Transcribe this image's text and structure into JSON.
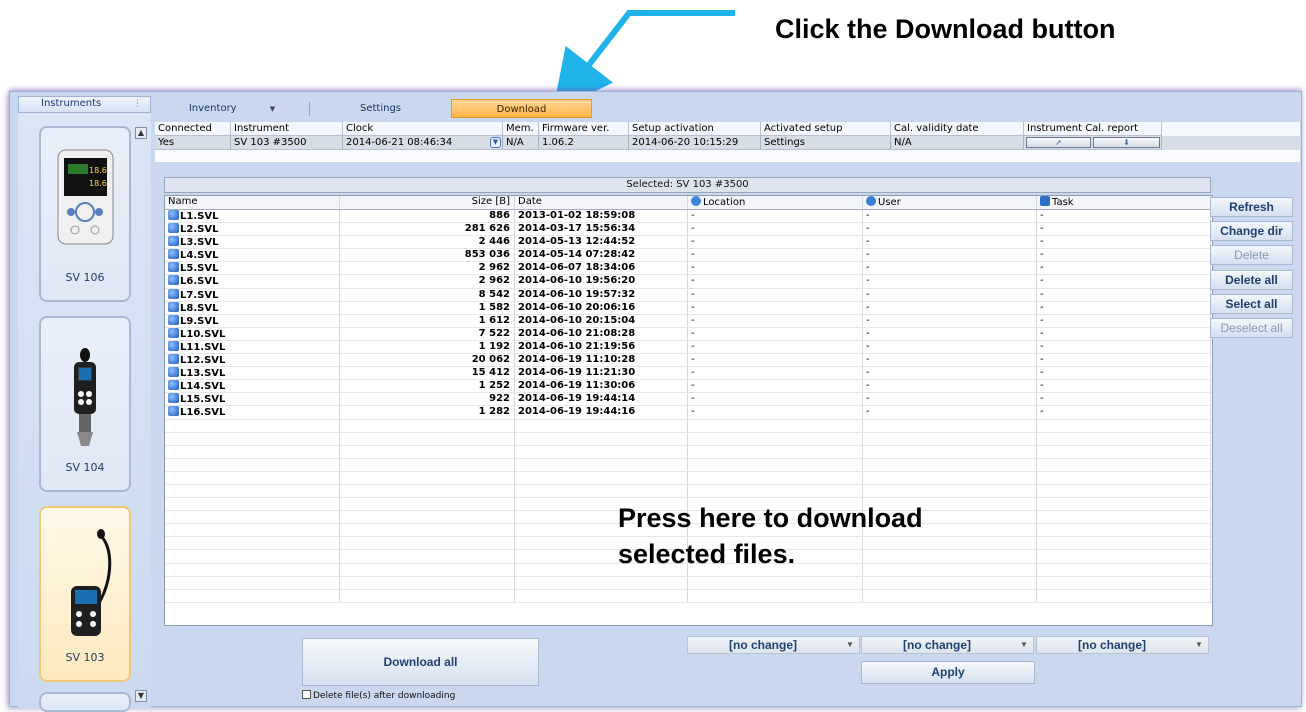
{
  "annotations": {
    "top": "Click the Download button",
    "middle_line1": "Press here to download",
    "middle_line2": "selected files."
  },
  "left_panel": {
    "header": "Instruments",
    "instruments": [
      {
        "label": "SV 106",
        "selected": false
      },
      {
        "label": "SV 104",
        "selected": false
      },
      {
        "label": "SV 103",
        "selected": true
      }
    ]
  },
  "tabs": [
    {
      "label": "Inventory",
      "active": false
    },
    {
      "label": "Settings",
      "active": false
    },
    {
      "label": "Download",
      "active": true
    }
  ],
  "instrument_grid": {
    "headers": [
      "Connected",
      "Instrument",
      "Clock",
      "Mem.",
      "Firmware ver.",
      "Setup activation",
      "Activated setup",
      "Cal. validity date",
      "Instrument Cal. report"
    ],
    "values": [
      "Yes",
      "SV 103 #3500",
      "2014-06-21 08:46:34",
      "N/A",
      "1.06.2",
      "2014-06-20 10:15:29",
      "Settings",
      "N/A",
      ""
    ]
  },
  "selected_banner": "Selected: SV 103 #3500",
  "file_table": {
    "headers": {
      "name": "Name",
      "size": "Size [B]",
      "date": "Date",
      "location": "Location",
      "user": "User",
      "task": "Task"
    },
    "rows": [
      {
        "name": "L1.SVL",
        "size": "886",
        "date": "2013-01-02 18:59:08",
        "location": "-",
        "user": "-",
        "task": "-"
      },
      {
        "name": "L2.SVL",
        "size": "281 626",
        "date": "2014-03-17 15:56:34",
        "location": "-",
        "user": "-",
        "task": "-"
      },
      {
        "name": "L3.SVL",
        "size": "2 446",
        "date": "2014-05-13 12:44:52",
        "location": "-",
        "user": "-",
        "task": "-"
      },
      {
        "name": "L4.SVL",
        "size": "853 036",
        "date": "2014-05-14 07:28:42",
        "location": "-",
        "user": "-",
        "task": "-"
      },
      {
        "name": "L5.SVL",
        "size": "2 962",
        "date": "2014-06-07 18:34:06",
        "location": "-",
        "user": "-",
        "task": "-"
      },
      {
        "name": "L6.SVL",
        "size": "2 962",
        "date": "2014-06-10 19:56:20",
        "location": "-",
        "user": "-",
        "task": "-"
      },
      {
        "name": "L7.SVL",
        "size": "8 542",
        "date": "2014-06-10 19:57:32",
        "location": "-",
        "user": "-",
        "task": "-"
      },
      {
        "name": "L8.SVL",
        "size": "1 582",
        "date": "2014-06-10 20:06:16",
        "location": "-",
        "user": "-",
        "task": "-"
      },
      {
        "name": "L9.SVL",
        "size": "1 612",
        "date": "2014-06-10 20:15:04",
        "location": "-",
        "user": "-",
        "task": "-"
      },
      {
        "name": "L10.SVL",
        "size": "7 522",
        "date": "2014-06-10 21:08:28",
        "location": "-",
        "user": "-",
        "task": "-"
      },
      {
        "name": "L11.SVL",
        "size": "1 192",
        "date": "2014-06-10 21:19:56",
        "location": "-",
        "user": "-",
        "task": "-"
      },
      {
        "name": "L12.SVL",
        "size": "20 062",
        "date": "2014-06-19 11:10:28",
        "location": "-",
        "user": "-",
        "task": "-"
      },
      {
        "name": "L13.SVL",
        "size": "15 412",
        "date": "2014-06-19 11:21:30",
        "location": "-",
        "user": "-",
        "task": "-"
      },
      {
        "name": "L14.SVL",
        "size": "1 252",
        "date": "2014-06-19 11:30:06",
        "location": "-",
        "user": "-",
        "task": "-"
      },
      {
        "name": "L15.SVL",
        "size": "922",
        "date": "2014-06-19 19:44:14",
        "location": "-",
        "user": "-",
        "task": "-"
      },
      {
        "name": "L16.SVL",
        "size": "1 282",
        "date": "2014-06-19 19:44:16",
        "location": "-",
        "user": "-",
        "task": "-"
      }
    ]
  },
  "side_buttons": [
    {
      "label": "Refresh",
      "enabled": true
    },
    {
      "label": "Change dir",
      "enabled": true
    },
    {
      "label": "Delete",
      "enabled": false
    },
    {
      "label": "Delete all",
      "enabled": true
    },
    {
      "label": "Select all",
      "enabled": true
    },
    {
      "label": "Deselect all",
      "enabled": false
    }
  ],
  "bottom": {
    "download_all": "Download all",
    "delete_after": "Delete file(s) after downloading",
    "location_combo": "[no change]",
    "user_combo": "[no change]",
    "task_combo": "[no change]",
    "apply": "Apply"
  },
  "colors": {
    "accent_arrow": "#1fb3ea",
    "active_tab": "#ffb447",
    "window_bg": "#c9d8ef"
  }
}
